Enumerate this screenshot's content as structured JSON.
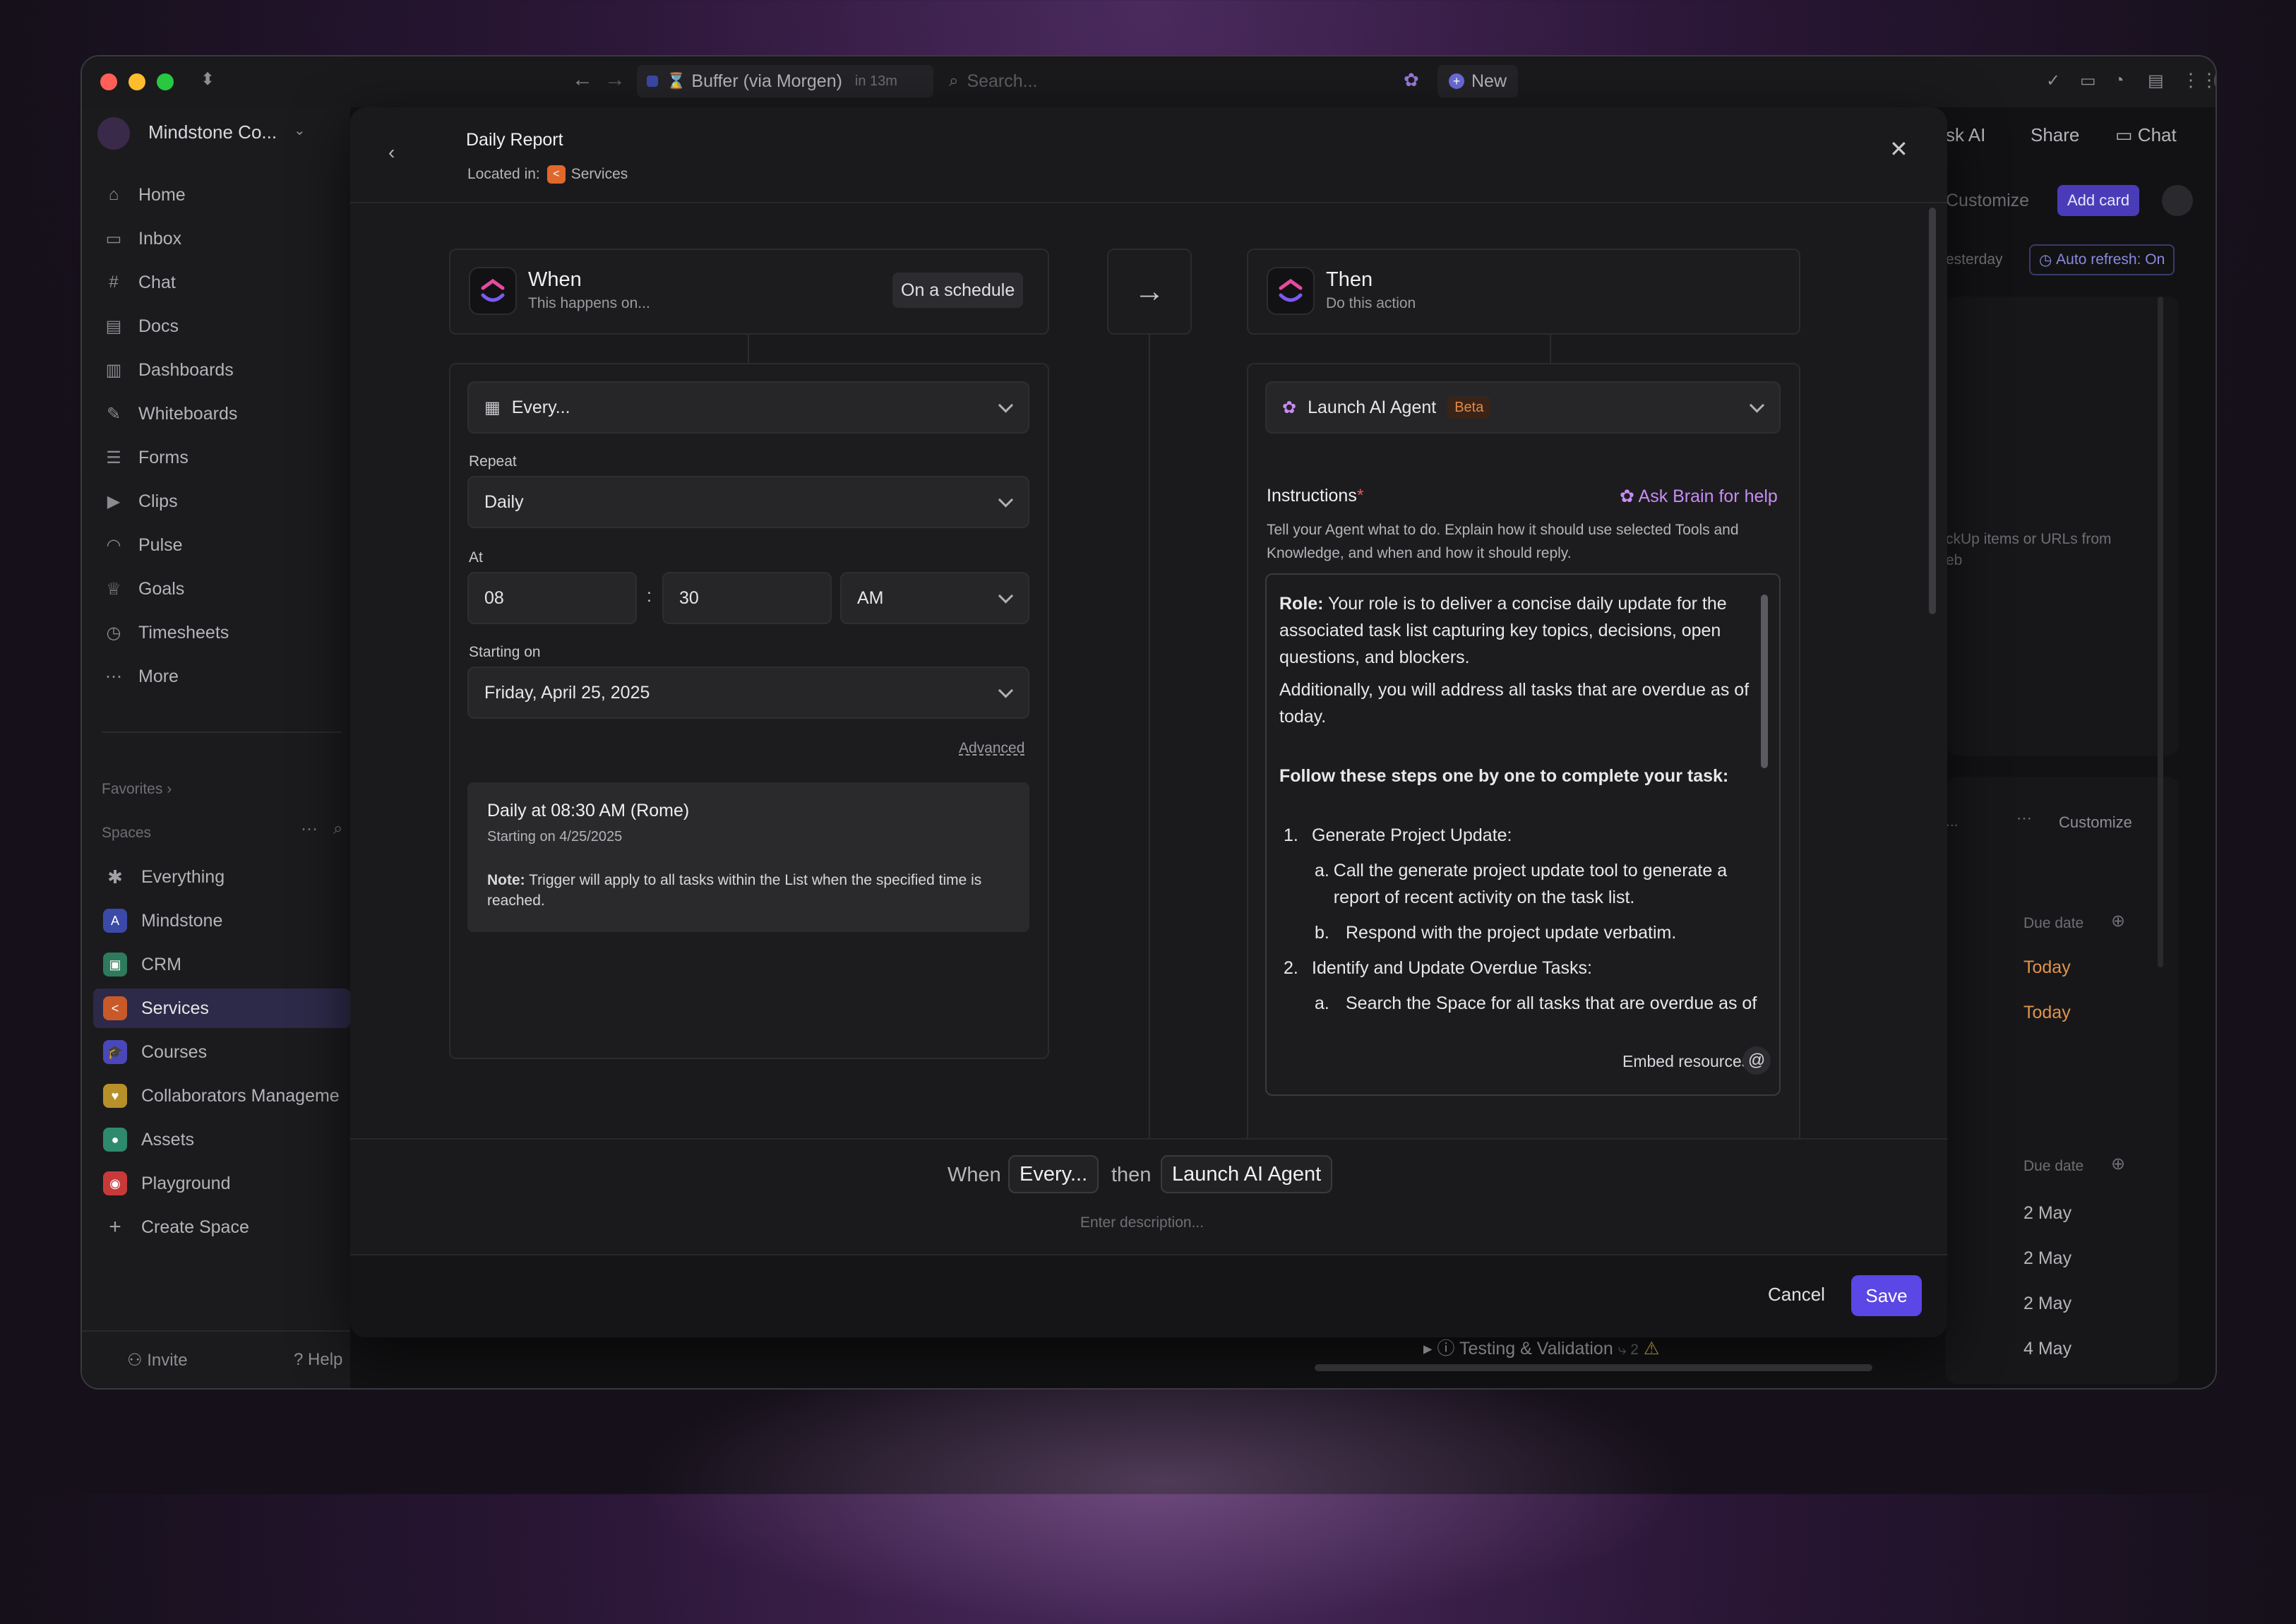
{
  "browser": {
    "tab_title": "Buffer (via Morgen)",
    "tab_time": "in 13m",
    "search_placeholder": "Search...",
    "new_label": "New"
  },
  "sidebar": {
    "workspace": "Mindstone Co...",
    "nav": [
      {
        "label": "Home",
        "icon": "home-icon"
      },
      {
        "label": "Inbox",
        "icon": "inbox-icon"
      },
      {
        "label": "Chat",
        "icon": "chat-icon"
      },
      {
        "label": "Docs",
        "icon": "docs-icon"
      },
      {
        "label": "Dashboards",
        "icon": "dashboards-icon"
      },
      {
        "label": "Whiteboards",
        "icon": "whiteboards-icon"
      },
      {
        "label": "Forms",
        "icon": "forms-icon"
      },
      {
        "label": "Clips",
        "icon": "clips-icon"
      },
      {
        "label": "Pulse",
        "icon": "pulse-icon"
      },
      {
        "label": "Goals",
        "icon": "goals-icon"
      },
      {
        "label": "Timesheets",
        "icon": "timesheets-icon"
      },
      {
        "label": "More",
        "icon": "more-icon"
      }
    ],
    "favorites_label": "Favorites",
    "spaces_label": "Spaces",
    "spaces": [
      {
        "label": "Everything",
        "color": "",
        "glyph": "✱"
      },
      {
        "label": "Mindstone",
        "color": "#3b4aa8",
        "glyph": "A"
      },
      {
        "label": "CRM",
        "color": "#2e7a5c",
        "glyph": "▣"
      },
      {
        "label": "Services",
        "color": "#c85a2a",
        "glyph": "<"
      },
      {
        "label": "Courses",
        "color": "#4a48b8",
        "glyph": "🎓"
      },
      {
        "label": "Collaborators Manageme",
        "color": "#b8902a",
        "glyph": "♥"
      },
      {
        "label": "Assets",
        "color": "#2e8a6c",
        "glyph": "●"
      },
      {
        "label": "Playground",
        "color": "#c83a3a",
        "glyph": "◉"
      }
    ],
    "create_space": "Create Space",
    "invite": "Invite",
    "help": "Help"
  },
  "background": {
    "ask_ai": "sk AI",
    "share": "Share",
    "chat": "Chat",
    "customize": "Customize",
    "add_card": "Add card",
    "yesterday": "esterday",
    "auto_refresh": "Auto refresh: On",
    "clickup_hint": "ckUp items or URLs from",
    "clickup_hint2": "eb",
    "customize2": "Customize",
    "due_date": "Due date",
    "rows_top": [
      "Today",
      "Today"
    ],
    "rows_bottom": [
      "2 May",
      "2 May",
      "2 May",
      "4 May"
    ],
    "task_name": "Testing & Validation",
    "task_count": "2"
  },
  "modal": {
    "title": "Daily Report",
    "located_prefix": "Located in:",
    "located_space": "Services",
    "when": {
      "title": "When",
      "subtitle": "This happens on...",
      "badge": "On a schedule"
    },
    "then": {
      "title": "Then",
      "subtitle": "Do this action"
    },
    "trigger": {
      "every": "Every...",
      "repeat_label": "Repeat",
      "repeat_value": "Daily",
      "at_label": "At",
      "hour": "08",
      "colon": ":",
      "minute": "30",
      "ampm": "AM",
      "starting_label": "Starting on",
      "starting_value": "Friday, April 25, 2025",
      "advanced": "Advanced",
      "summary_title": "Daily at 08:30 AM (Rome)",
      "summary_sub": "Starting on 4/25/2025",
      "note_label": "Note:",
      "note_text": " Trigger will apply to all tasks within the List when the specified time is reached."
    },
    "action": {
      "name": "Launch AI Agent",
      "beta": "Beta",
      "instructions_label": "Instructions",
      "required": "*",
      "ask_brain": "Ask Brain for help",
      "help_text": "Tell your Agent what to do. Explain how it should use selected Tools and Knowledge, and when and how it should reply.",
      "role_label": "Role:",
      "role_text": " Your role is to deliver a concise daily update for the associated task list capturing key topics, decisions, open questions, and blockers.",
      "additional": "Additionally, you will address all tasks that are overdue as of today.",
      "steps_heading": "Follow these steps one by one to complete your task:",
      "step1": "Generate Project Update:",
      "step1a": "Call the generate project update tool to generate a report of recent activity on the task list.",
      "step1b": "Respond with the project update verbatim.",
      "step2": "Identify and Update Overdue Tasks:",
      "step2a": "Search the Space for all tasks that are overdue as of",
      "embed": "Embed resources."
    },
    "footer": {
      "when": "When",
      "every": "Every...",
      "then": "then",
      "action": "Launch AI Agent",
      "description_placeholder": "Enter description...",
      "cancel": "Cancel",
      "save": "Save"
    }
  },
  "colors": {
    "accent": "#5b46e6",
    "beta_bg": "#3a2418",
    "beta_fg": "#e08a4a",
    "brain": "#c88cf2",
    "required": "#e05a5a"
  }
}
